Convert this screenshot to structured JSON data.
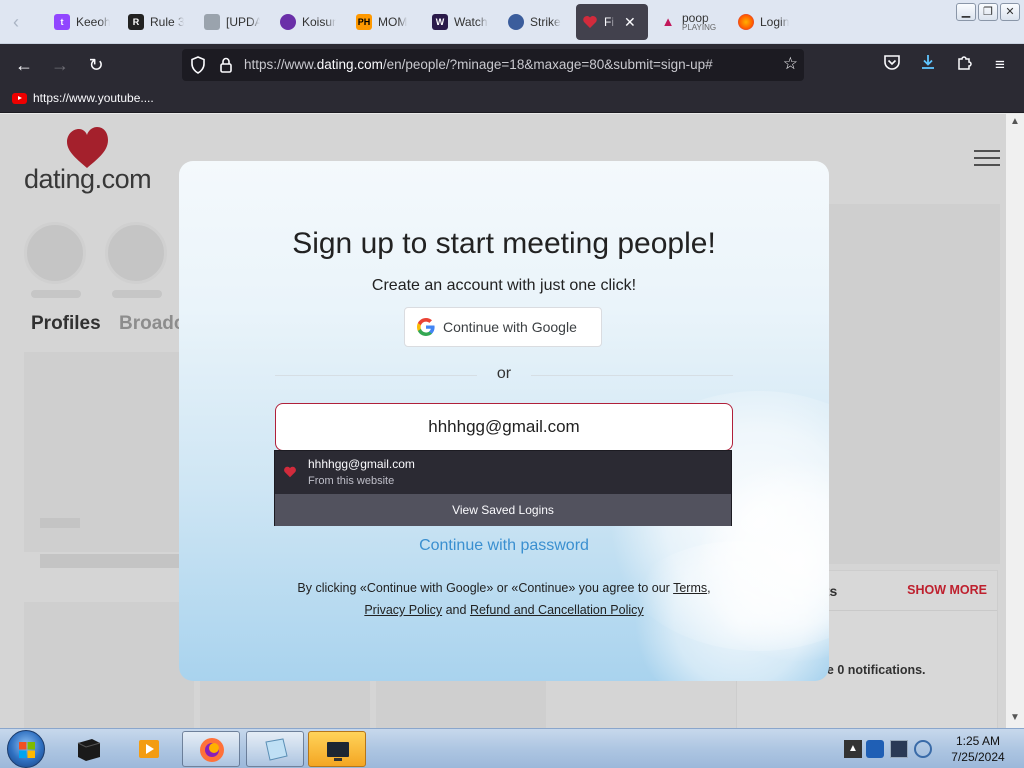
{
  "browser": {
    "tabs": [
      {
        "label": "Keeoh",
        "icon": "twitch-icon",
        "color": "#9146ff"
      },
      {
        "label": "Rule 3",
        "icon": "rule-icon",
        "color": "#222222"
      },
      {
        "label": "[UPDA",
        "icon": "page-icon",
        "color": "#9aa3ad"
      },
      {
        "label": "Koisun",
        "icon": "koisun-icon",
        "color": "#6a2fa8"
      },
      {
        "label": "MOM",
        "icon": "ph-icon",
        "color": "#ff9900"
      },
      {
        "label": "Watch",
        "icon": "watch-icon",
        "color": "#2a1a4a"
      },
      {
        "label": "Strike",
        "icon": "strike-icon",
        "color": "#3b5d9c"
      },
      {
        "label": "Fi",
        "icon": "dating-icon",
        "color": "#d12b3c",
        "active": true
      },
      {
        "label": "poop",
        "sub": "PLAYING",
        "icon": "poop-icon",
        "color": "#c2185b"
      },
      {
        "label": "Login",
        "icon": "firefox-icon",
        "color": "#ff7139"
      }
    ],
    "url_prefix": "https://www.",
    "url_domain": "dating.com",
    "url_path": "/en/people/?minage=18&maxage=80&submit=sign-up#",
    "bookmark": "https://www.youtube...."
  },
  "site": {
    "logo": "dating.com",
    "tabs": {
      "profiles": "Profiles",
      "broadcasts": "Broadc"
    },
    "notifications": {
      "title": "sts",
      "more": "SHOW MORE",
      "body": "ave 0 notifications."
    }
  },
  "modal": {
    "title": "Sign up to start meeting people!",
    "subtitle": "Create an account with just one click!",
    "google_button": "Continue with Google",
    "or": "or",
    "email_value": "hhhhgg@gmail.com",
    "continue_password": "Continue with password",
    "terms_1": "By clicking «Continue with Google» or «Continue» you agree to our ",
    "terms_link": "Terms",
    "terms_comma": ",",
    "privacy": "Privacy Policy",
    "and": " and ",
    "refund": "Refund and Cancellation Policy"
  },
  "autofill": {
    "email": "hhhhgg@gmail.com",
    "source": "From this website",
    "view_saved": "View Saved Logins"
  },
  "taskbar": {
    "time": "1:25 AM",
    "date": "7/25/2024"
  },
  "colors": {
    "accent": "#d0202f",
    "link": "#3a8fd0",
    "browser_dark": "#2b2a33"
  }
}
